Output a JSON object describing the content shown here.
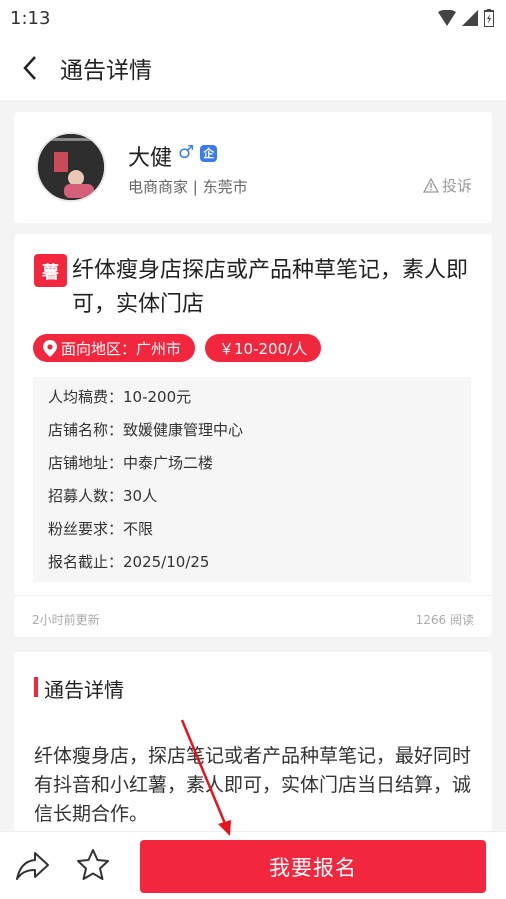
{
  "status": {
    "time": "1:13"
  },
  "appbar": {
    "title": "通告详情"
  },
  "user": {
    "name": "大健",
    "gender_icon": "male-icon",
    "enterprise_badge": "企",
    "meta": "电商商家 | 东莞市",
    "report_label": "投诉"
  },
  "post": {
    "tag": "薯",
    "title": "纤体瘦身店探店或产品种草笔记，素人即可，实体门店",
    "region_chip": "面向地区：广州市",
    "price_chip": "￥10-200/人",
    "info": [
      "人均稿费：10-200元",
      "店铺名称：致媛健康管理中心",
      "店铺地址：中泰广场二楼",
      "招募人数：30人",
      "粉丝要求：不限",
      "报名截止：2025/10/25"
    ],
    "updated": "2小时前更新",
    "reads": "1266 阅读"
  },
  "detail": {
    "section_title": "通告详情",
    "text": "纤体瘦身店，探店笔记或者产品种草笔记，最好同时有抖音和小红薯，素人即可，实体门店当日结算，诚信长期合作。"
  },
  "bottom": {
    "signup_label": "我要报名"
  },
  "colors": {
    "accent": "#f2263d",
    "badge_blue": "#3a7bf0"
  }
}
